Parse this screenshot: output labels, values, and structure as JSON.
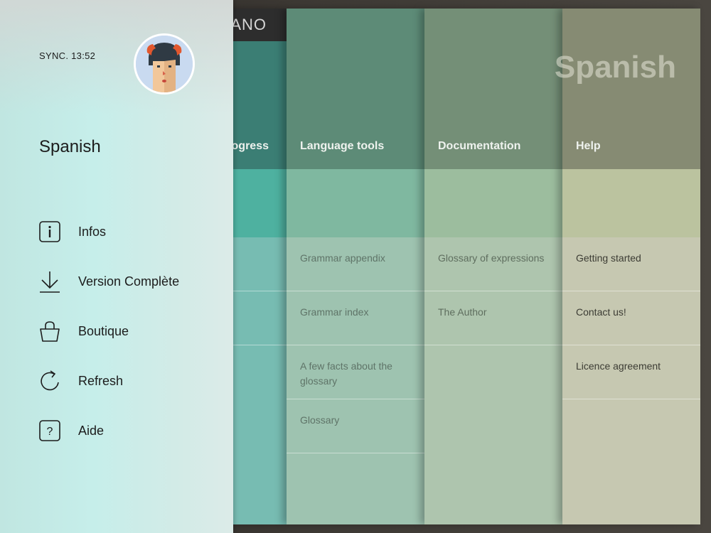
{
  "header": {
    "logo_text": "ANO"
  },
  "page": {
    "language_title": "Spanish"
  },
  "columns": [
    {
      "id": "progress",
      "title": "Progress",
      "rows": [
        "",
        ""
      ]
    },
    {
      "id": "language-tools",
      "title": "Language tools",
      "rows": [
        "Grammar appendix",
        "Grammar index",
        "A few facts about the glossary",
        "Glossary"
      ]
    },
    {
      "id": "documentation",
      "title": "Documentation",
      "rows": [
        "Glossary of expressions",
        "The Author"
      ]
    },
    {
      "id": "help",
      "title": "Help",
      "rows": [
        "Getting started",
        "Contact us!",
        "Licence agreement"
      ]
    }
  ],
  "drawer": {
    "sync_text": "SYNC. 13:52",
    "title": "Spanish",
    "menu": [
      {
        "label": "Infos",
        "icon": "info-icon"
      },
      {
        "label": "Version Complète",
        "icon": "download-icon"
      },
      {
        "label": "Boutique",
        "icon": "shopping-bag-icon"
      },
      {
        "label": "Refresh",
        "icon": "refresh-icon"
      },
      {
        "label": "Aide",
        "icon": "help-icon"
      }
    ]
  },
  "colors": {
    "progress_head": "#3b7e74",
    "progress_band": "#4eb1a0",
    "progress_body": "#77bcb2",
    "tools_head": "#5d8b77",
    "tools_band": "#7fb8a0",
    "tools_body": "#9ec3b0",
    "docs_head": "#748f77",
    "docs_band": "#9cbd9e",
    "docs_body": "#aec5ae",
    "help_head": "#868b73",
    "help_band": "#bbc39f",
    "help_body": "#c6c8b1",
    "drawer_bg": "#c6eeea",
    "avatar_bg": "#c9daf0"
  }
}
